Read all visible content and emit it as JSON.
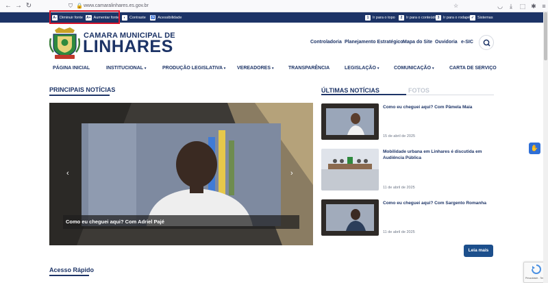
{
  "browser": {
    "url": "www.camaralinhares.es.gov.br",
    "back_icon": "back-arrow-icon",
    "forward_icon": "forward-arrow-icon",
    "reload_icon": "reload-icon"
  },
  "accessibility_bar": {
    "decrease_font": {
      "key": "A-",
      "label": "Diminuir fonte"
    },
    "increase_font": {
      "key": "A+",
      "label": "Aumentar fonte"
    },
    "contrast": {
      "label": "Contraste"
    },
    "accessibility": {
      "label": "Acessibilidade"
    },
    "go_top": {
      "key": "1",
      "label": "Ir para o topo"
    },
    "go_content": {
      "key": "2",
      "label": "Ir para o conteúdo"
    },
    "go_footer": {
      "key": "3",
      "label": "Ir para o rodapé"
    },
    "systems": {
      "label": "Sistemas"
    }
  },
  "header": {
    "brand_line1": "CAMARA MUNICIPAL DE",
    "brand_line2": "LINHARES",
    "links": [
      "Controladoria",
      "Planejamento Estratégico",
      "Mapa do Site",
      "Ouvidoria",
      "e-SIC"
    ]
  },
  "menu": [
    {
      "label": "PÁGINA INICIAL",
      "dropdown": false
    },
    {
      "label": "INSTITUCIONAL",
      "dropdown": true
    },
    {
      "label": "PRODUÇÃO LEGISLATIVA",
      "dropdown": true
    },
    {
      "label": "VEREADORES",
      "dropdown": true
    },
    {
      "label": "TRANSPARÊNCIA",
      "dropdown": false
    },
    {
      "label": "LEGISLAÇÃO",
      "dropdown": true
    },
    {
      "label": "COMUNICAÇÃO",
      "dropdown": true
    },
    {
      "label": "CARTA DE SERVIÇO",
      "dropdown": false
    }
  ],
  "main": {
    "section_title": "PRINCIPAIS NOTÍCIAS",
    "hero_caption": "Como eu cheguei aqui? Com Adriel Pajé",
    "quick_access_title": "Acesso Rápido"
  },
  "news": {
    "tab_latest": "ÚLTIMAS NOTÍCIAS",
    "tab_photos": "FOTOS",
    "items": [
      {
        "title": "Como eu cheguei aqui? Com Pâmela Maia",
        "date": "15 de abril de 2025"
      },
      {
        "title": "Mobilidade urbana em Linhares é discutida em Audiência Pública",
        "date": "11 de abril de 2025"
      },
      {
        "title": "Como eu cheguei aqui? Com Sargento Romanha",
        "date": "11 de abril de 2025"
      }
    ],
    "more_label": "Leia mais"
  },
  "recaptcha": {
    "text": "Privacidade - Termos"
  },
  "colors": {
    "primary": "#1c3366",
    "highlight": "#d9142b",
    "button": "#1c4f8c"
  }
}
